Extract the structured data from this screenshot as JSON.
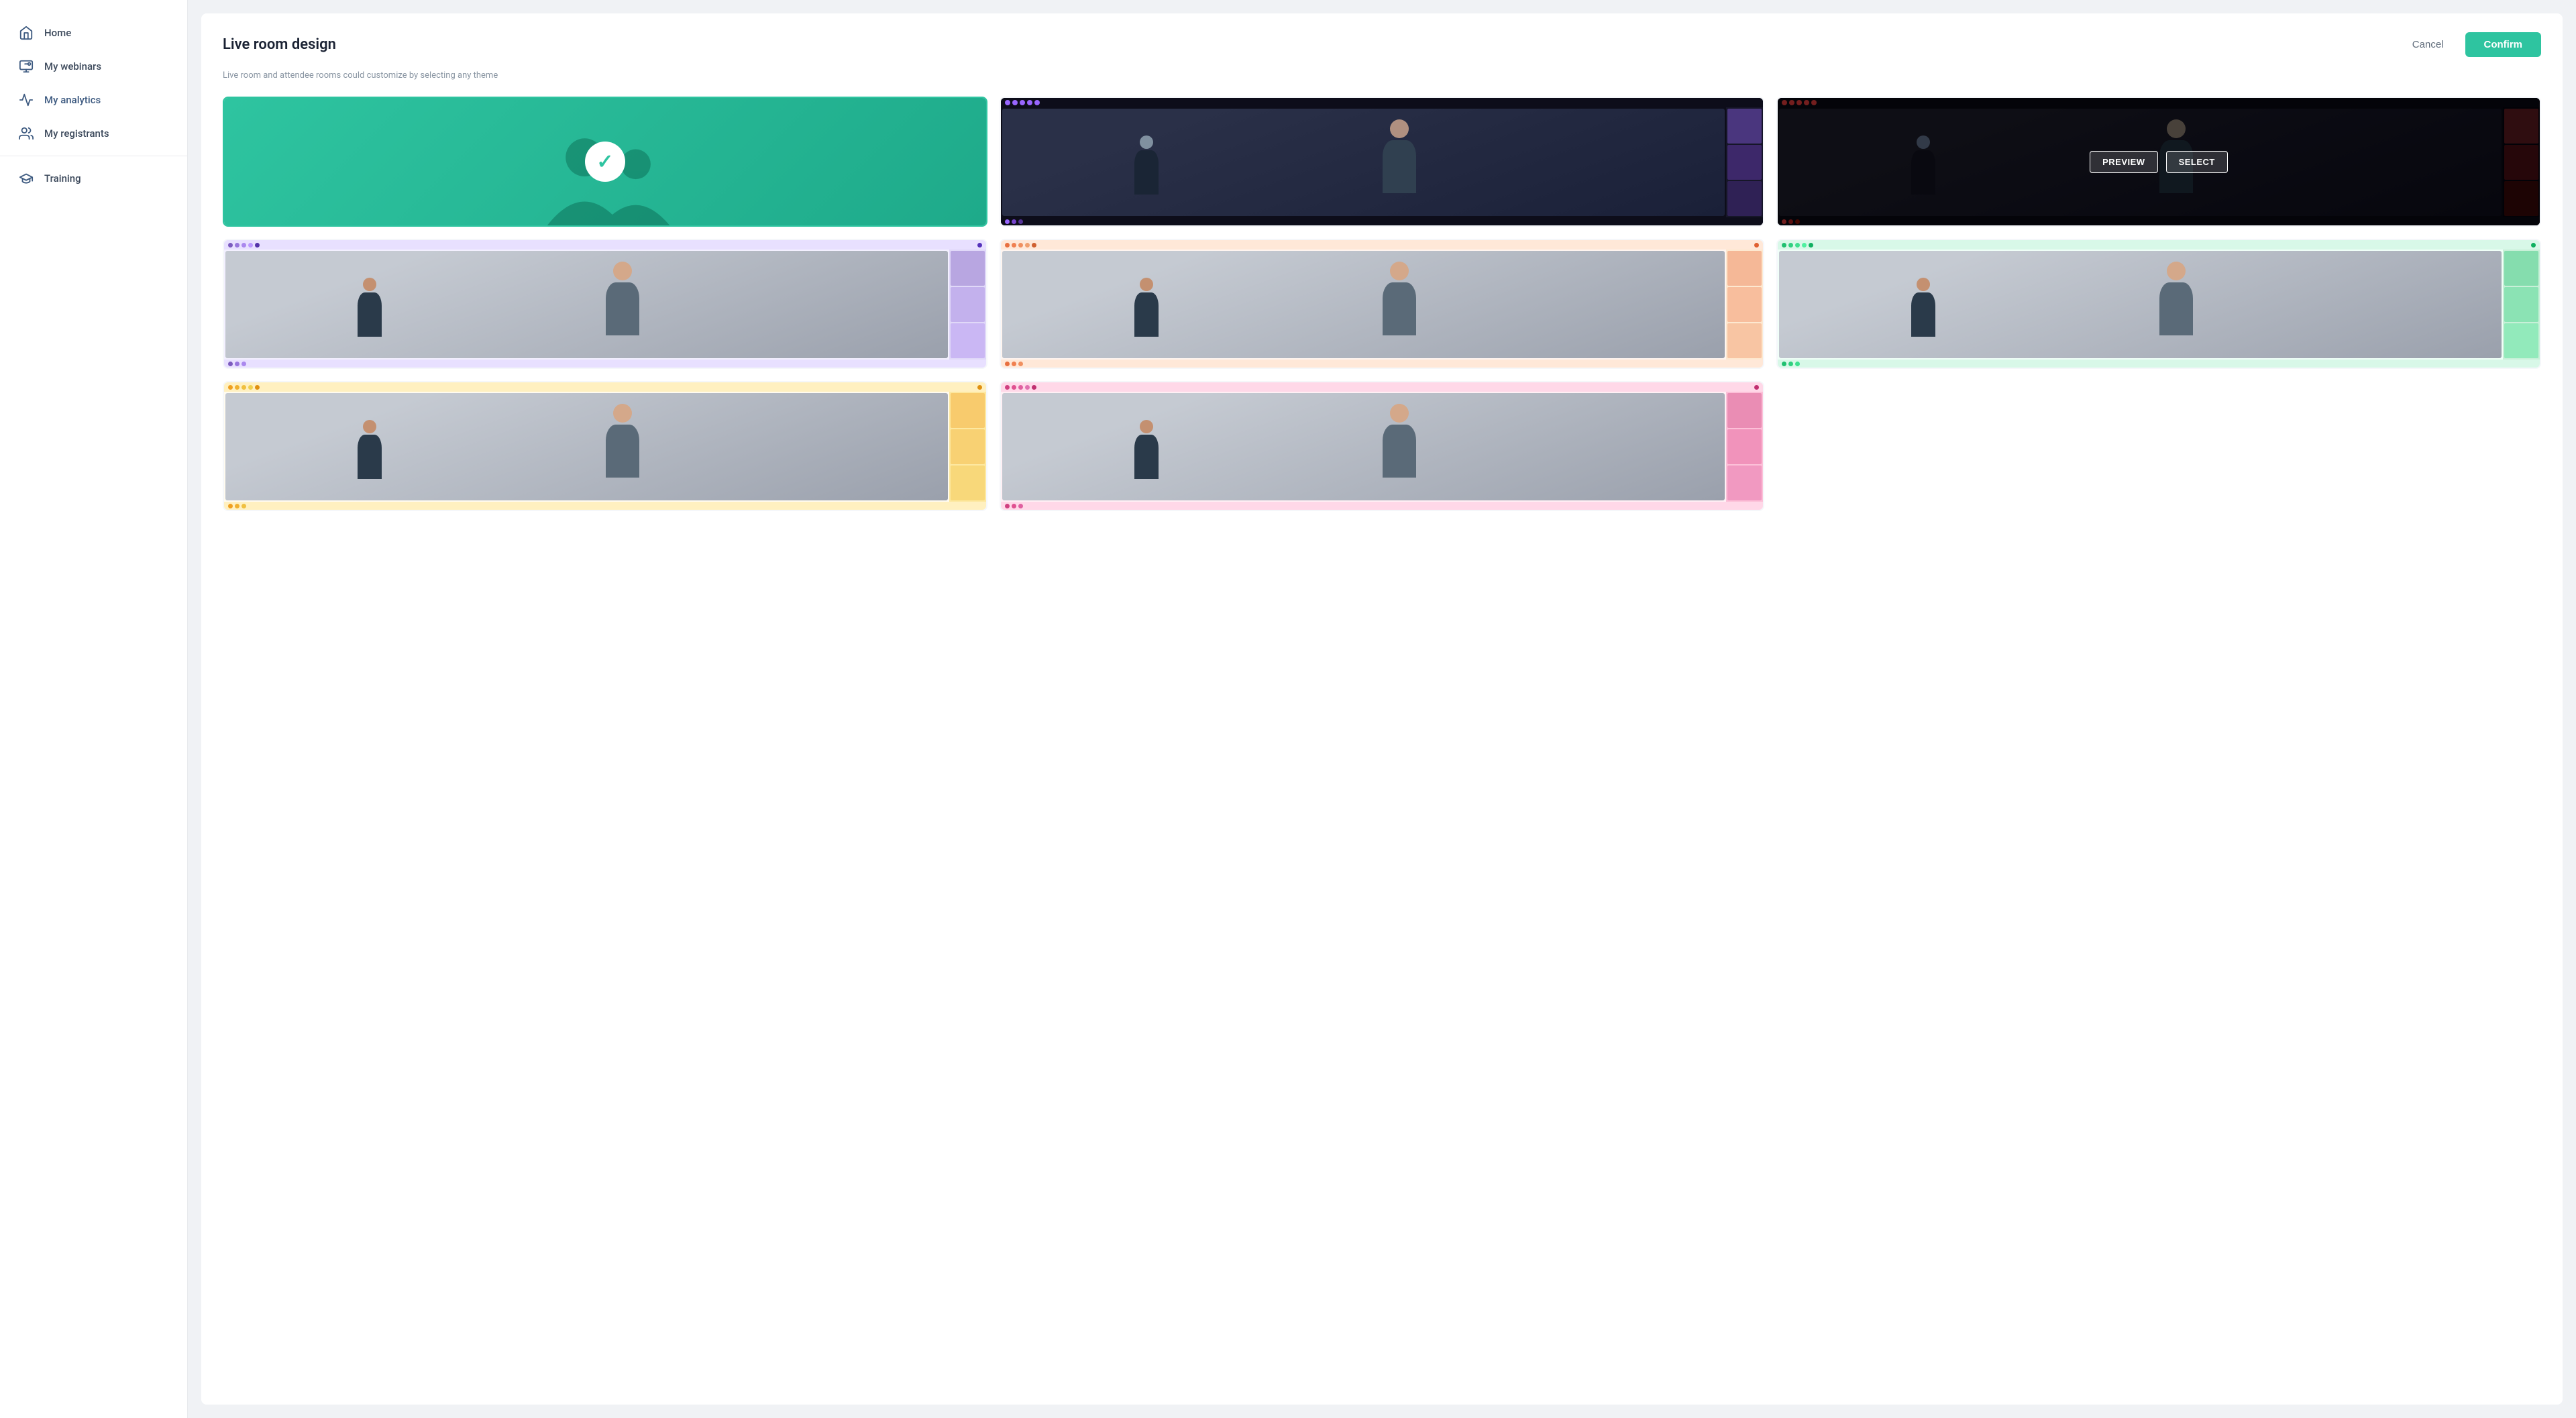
{
  "sidebar": {
    "items": [
      {
        "id": "home",
        "label": "Home",
        "icon": "home"
      },
      {
        "id": "my-webinars",
        "label": "My webinars",
        "icon": "webinars"
      },
      {
        "id": "my-analytics",
        "label": "My analytics",
        "icon": "analytics"
      },
      {
        "id": "my-registrants",
        "label": "My registrants",
        "icon": "registrants"
      },
      {
        "id": "training",
        "label": "Training",
        "icon": "training"
      }
    ]
  },
  "page": {
    "title": "Live room design",
    "subtitle": "Live room and attendee rooms could customize by selecting any theme",
    "cancel_label": "Cancel",
    "confirm_label": "Confirm"
  },
  "themes": [
    {
      "id": "theme-1",
      "type": "selected-green",
      "selected": true
    },
    {
      "id": "theme-2",
      "type": "dark",
      "selected": false,
      "accent": "#1a1a2e",
      "dots": [
        "#9966ff",
        "#9966ff",
        "#9966ff",
        "#9966ff",
        "#9966ff"
      ]
    },
    {
      "id": "theme-3",
      "type": "dark-hover",
      "selected": false,
      "preview_label": "PREVIEW",
      "select_label": "SELECT",
      "dots": [
        "#ff4444",
        "#ff4444",
        "#ff4444",
        "#ff4444",
        "#ff4444"
      ]
    },
    {
      "id": "theme-4",
      "type": "light",
      "selected": false,
      "bg": "#f3f0ff",
      "accent": "#7c5cbf",
      "dots": [
        "#7c5cbf",
        "#9977dd",
        "#aa88ee",
        "#bb99ff",
        "#5533aa"
      ],
      "dot_accent": "#5533bb"
    },
    {
      "id": "theme-5",
      "type": "light",
      "selected": false,
      "bg": "#fff5f0",
      "accent": "#e87040",
      "dots": [
        "#e87040",
        "#f08050",
        "#f09060",
        "#f0a070",
        "#d06030"
      ],
      "dot_accent": "#e06030"
    },
    {
      "id": "theme-6",
      "type": "light",
      "selected": false,
      "bg": "#f0fff8",
      "accent": "#20c070",
      "dots": [
        "#20c070",
        "#30d080",
        "#40e090",
        "#50f0a0",
        "#10b060"
      ],
      "dot_accent": "#10b060"
    },
    {
      "id": "theme-7",
      "type": "light",
      "selected": false,
      "bg": "#fffbf0",
      "accent": "#f0a020",
      "dots": [
        "#f0a020",
        "#f0b030",
        "#f0c040",
        "#f0d050",
        "#e09010"
      ],
      "dot_accent": "#e09010"
    },
    {
      "id": "theme-8",
      "type": "light",
      "selected": false,
      "bg": "#fff0f5",
      "accent": "#d04080",
      "dots": [
        "#d04080",
        "#e05090",
        "#e060a0",
        "#e070b0",
        "#c03070"
      ],
      "dot_accent": "#c03070"
    }
  ]
}
